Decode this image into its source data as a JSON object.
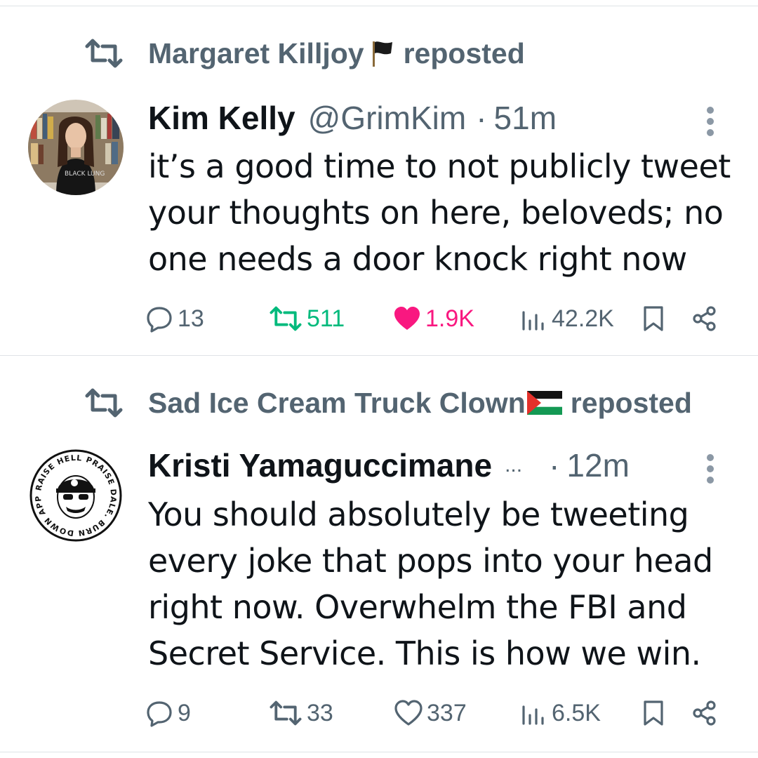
{
  "tweets": [
    {
      "reposted_by": "Margaret Killjoy",
      "reposted_by_emoji": "black-flag",
      "repost_suffix": "reposted",
      "author": {
        "display_name": "Kim Kelly",
        "handle": "@GrimKim",
        "time": "51m",
        "avatar": "profile photo"
      },
      "text_lines": [
        "it’s a good time to not publicly tweet",
        "your thoughts on here, beloveds; no",
        "one needs a door knock right now"
      ],
      "stats": {
        "replies": "13",
        "reposts": "511",
        "likes": "1.9K",
        "views": "42.2K",
        "reposted_by_viewer": true,
        "liked_by_viewer": true
      }
    },
    {
      "reposted_by": "Sad Ice Cream Truck Clown",
      "reposted_by_emoji": "palestine-flag",
      "repost_suffix": "reposted",
      "author": {
        "display_name": "Kristi Yamaguccimane",
        "truncation": "...",
        "time": "12m",
        "avatar": "sticker logo"
      },
      "avatar_text": "RAISE HELL PRAISE DALE. BURN DOWN APPLEBEE'S.",
      "text_lines": [
        "You should absolutely be tweeting",
        "every joke that pops into your head",
        "right now. Overwhelm the FBI and",
        "Secret Service. This is how we win."
      ],
      "stats": {
        "replies": "9",
        "reposts": "33",
        "likes": "337",
        "views": "6.5K",
        "reposted_by_viewer": false,
        "liked_by_viewer": false
      }
    }
  ],
  "separator": "·",
  "colors": {
    "text": "#0f1419",
    "secondary": "#536471",
    "repost_active": "#00ba7c",
    "like_active": "#f91880",
    "divider": "#dfe3e6"
  },
  "icons": [
    "repost-icon",
    "reply-icon",
    "like-icon",
    "views-icon",
    "bookmark-icon",
    "share-icon",
    "more-icon"
  ]
}
